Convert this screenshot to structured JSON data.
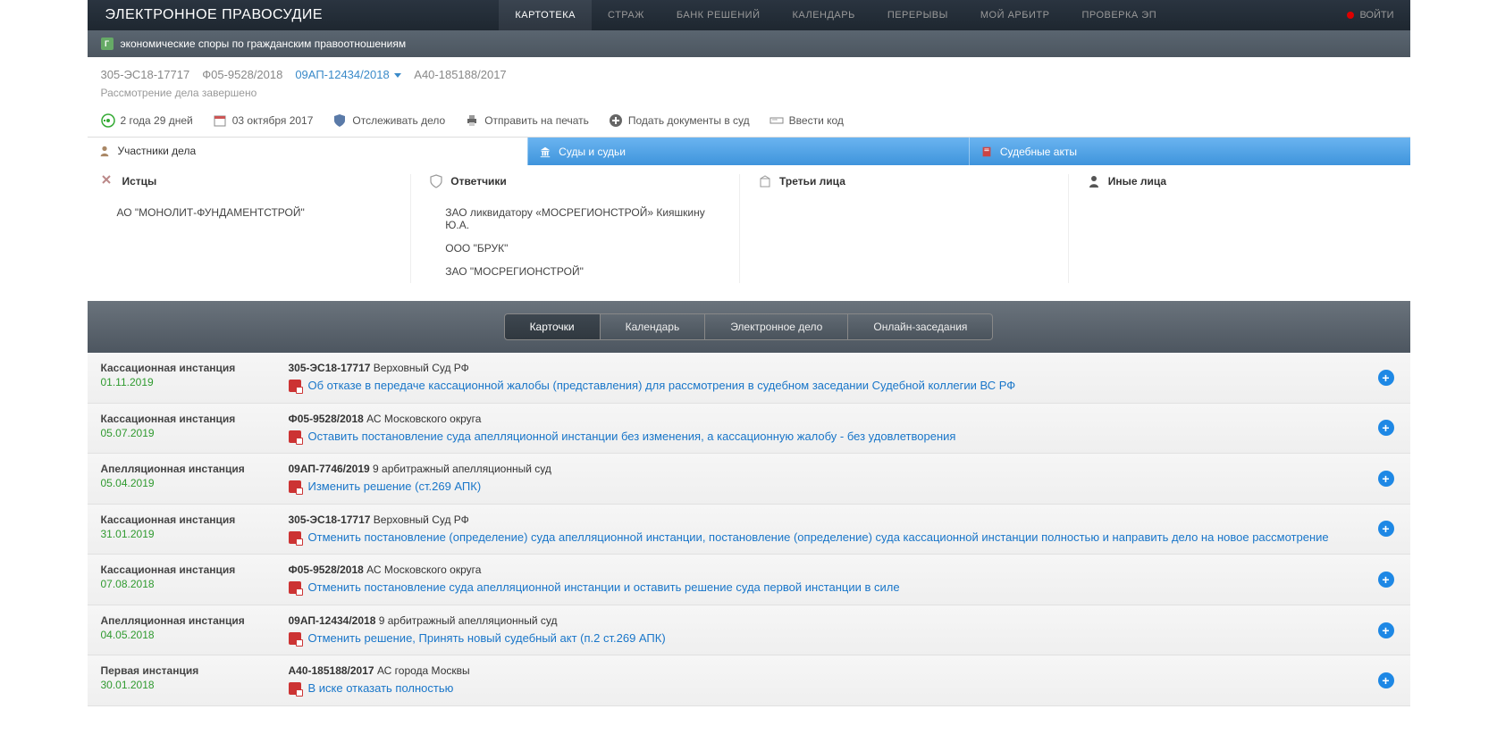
{
  "header": {
    "logo": "ЭЛЕКТРОННОЕ ПРАВОСУДИЕ",
    "nav": [
      "КАРТОТЕКА",
      "СТРАЖ",
      "БАНК РЕШЕНИЙ",
      "КАЛЕНДАРЬ",
      "ПЕРЕРЫВЫ",
      "МОЙ АРБИТР",
      "ПРОВЕРКА ЭП"
    ],
    "active_nav": 0,
    "login": "ВОЙТИ"
  },
  "subbar": {
    "badge": "Г",
    "text": "экономические споры по гражданским правоотношениям"
  },
  "case": {
    "numbers": [
      "305-ЭС18-17717",
      "Ф05-9528/2018",
      "09АП-12434/2018",
      "А40-185188/2017"
    ],
    "dropdown_index": 2,
    "status": "Рассмотрение дела завершено"
  },
  "toolbar": {
    "duration": "2 года 29 дней",
    "filed": "03 октября 2017",
    "track": "Отслеживать дело",
    "print": "Отправить на печать",
    "file_docs": "Подать документы в суд",
    "enter_code": "Ввести код"
  },
  "tabs": {
    "participants": "Участники дела",
    "courts": "Суды и судьи",
    "acts": "Судебные акты"
  },
  "parties": {
    "plaintiffs_label": "Истцы",
    "plaintiffs": [
      "АО \"МОНОЛИТ-ФУНДАМЕНТСТРОЙ\""
    ],
    "defendants_label": "Ответчики",
    "defendants": [
      "ЗАО ликвидатору «МОСРЕГИОНСТРОЙ» Кияшкину Ю.А.",
      "ООО \"БРУК\"",
      "ЗАО \"МОСРЕГИОНСТРОЙ\""
    ],
    "third_label": "Третьи лица",
    "third": [],
    "other_label": "Иные лица",
    "other": []
  },
  "subtabs": [
    "Карточки",
    "Календарь",
    "Электронное дело",
    "Онлайн-заседания"
  ],
  "subtab_active": 0,
  "rows": [
    {
      "instance": "Кассационная инстанция",
      "date": "01.11.2019",
      "case_no": "305-ЭС18-17717",
      "court": "Верховный Суд РФ",
      "title": "Об отказе в передаче кассационной жалобы (представления) для рассмотрения в судебном заседании Судебной коллегии ВС РФ"
    },
    {
      "instance": "Кассационная инстанция",
      "date": "05.07.2019",
      "case_no": "Ф05-9528/2018",
      "court": "АС Московского округа",
      "title": "Оставить постановление суда апелляционной инстанции без изменения, а кассационную жалобу - без удовлетворения"
    },
    {
      "instance": "Апелляционная инстанция",
      "date": "05.04.2019",
      "case_no": "09АП-7746/2019",
      "court": "9 арбитражный апелляционный суд",
      "title": "Изменить решение (ст.269 АПК)"
    },
    {
      "instance": "Кассационная инстанция",
      "date": "31.01.2019",
      "case_no": "305-ЭС18-17717",
      "court": "Верховный Суд РФ",
      "title": "Отменить постановление (определение) суда апелляционной инстанции, постановление (определение) суда кассационной инстанции полностью и направить дело на новое рассмотрение"
    },
    {
      "instance": "Кассационная инстанция",
      "date": "07.08.2018",
      "case_no": "Ф05-9528/2018",
      "court": "АС Московского округа",
      "title": "Отменить постановление суда апелляционной инстанции и оставить решение суда первой инстанции в силе"
    },
    {
      "instance": "Апелляционная инстанция",
      "date": "04.05.2018",
      "case_no": "09АП-12434/2018",
      "court": "9 арбитражный апелляционный суд",
      "title": "Отменить решение, Принять новый судебный акт (п.2 ст.269 АПК)"
    },
    {
      "instance": "Первая инстанция",
      "date": "30.01.2018",
      "case_no": "А40-185188/2017",
      "court": "АС города Москвы",
      "title": "В иске отказать полностью"
    }
  ]
}
